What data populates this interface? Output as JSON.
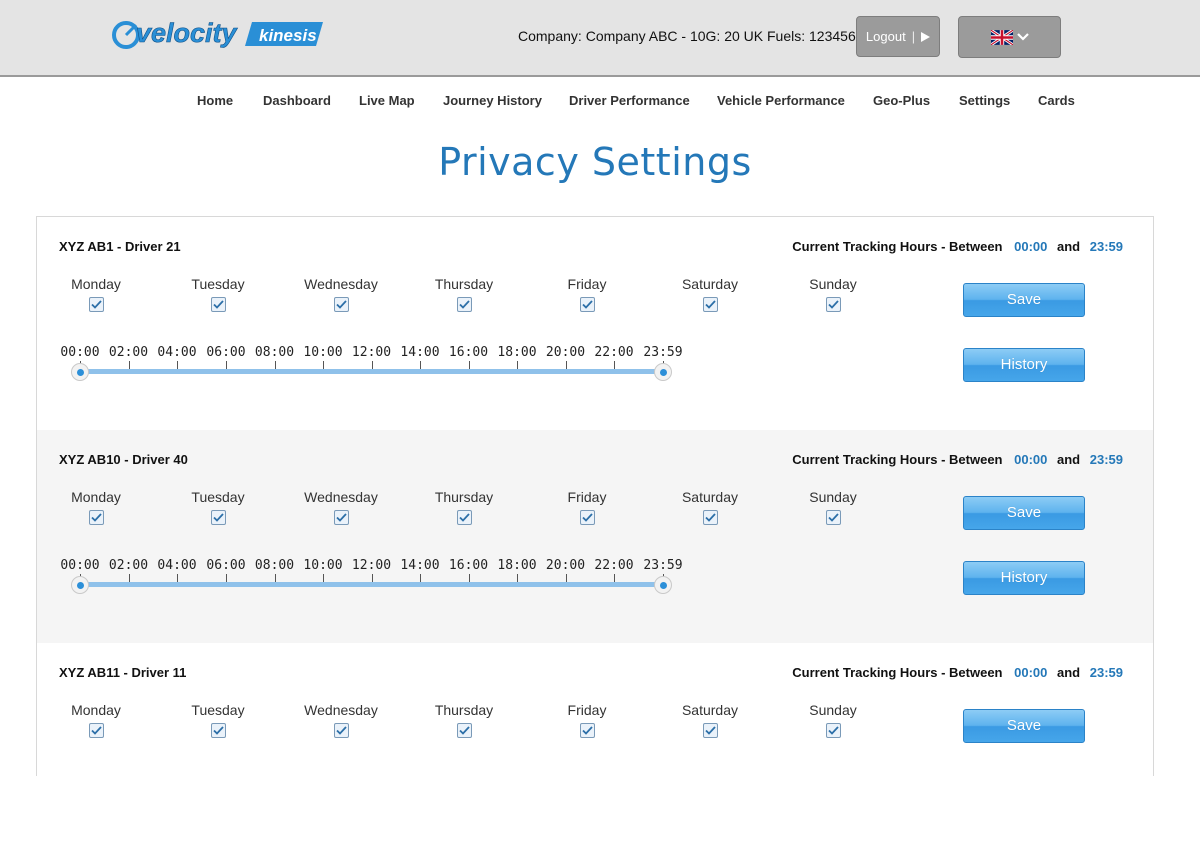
{
  "header": {
    "logo_text": "velocity",
    "logo_sub": "kinesis",
    "company_label": "Company:",
    "company_value": "Company ABC - 10G: 20 UK Fuels: 123456",
    "logout_label": "Logout",
    "language_icon": "uk-flag-icon"
  },
  "nav": [
    "Home",
    "Dashboard",
    "Live Map",
    "Journey History",
    "Driver Performance",
    "Vehicle Performance",
    "Geo-Plus",
    "Settings",
    "Cards"
  ],
  "page_title": "Privacy Settings",
  "days": [
    "Monday",
    "Tuesday",
    "Wednesday",
    "Thursday",
    "Friday",
    "Saturday",
    "Sunday"
  ],
  "ticks": [
    "00:00",
    "02:00",
    "04:00",
    "06:00",
    "08:00",
    "10:00",
    "12:00",
    "14:00",
    "16:00",
    "18:00",
    "20:00",
    "22:00",
    "23:59"
  ],
  "tracking_label": "Current Tracking Hours - Between",
  "and_label": "and",
  "save_label": "Save",
  "history_label": "History",
  "drivers": [
    {
      "name": "XYZ AB1 - Driver 21",
      "start": "00:00",
      "end": "23:59",
      "days_checked": [
        true,
        true,
        true,
        true,
        true,
        true,
        true
      ]
    },
    {
      "name": "XYZ AB10 - Driver 40",
      "start": "00:00",
      "end": "23:59",
      "days_checked": [
        true,
        true,
        true,
        true,
        true,
        true,
        true
      ]
    },
    {
      "name": "XYZ AB11 - Driver 11",
      "start": "00:00",
      "end": "23:59",
      "days_checked": [
        true,
        true,
        true,
        true,
        true,
        true,
        true
      ]
    }
  ],
  "colors": {
    "accent": "#2478b8",
    "button_blue": "#4aa6ea",
    "header_bg": "#e4e4e4"
  }
}
